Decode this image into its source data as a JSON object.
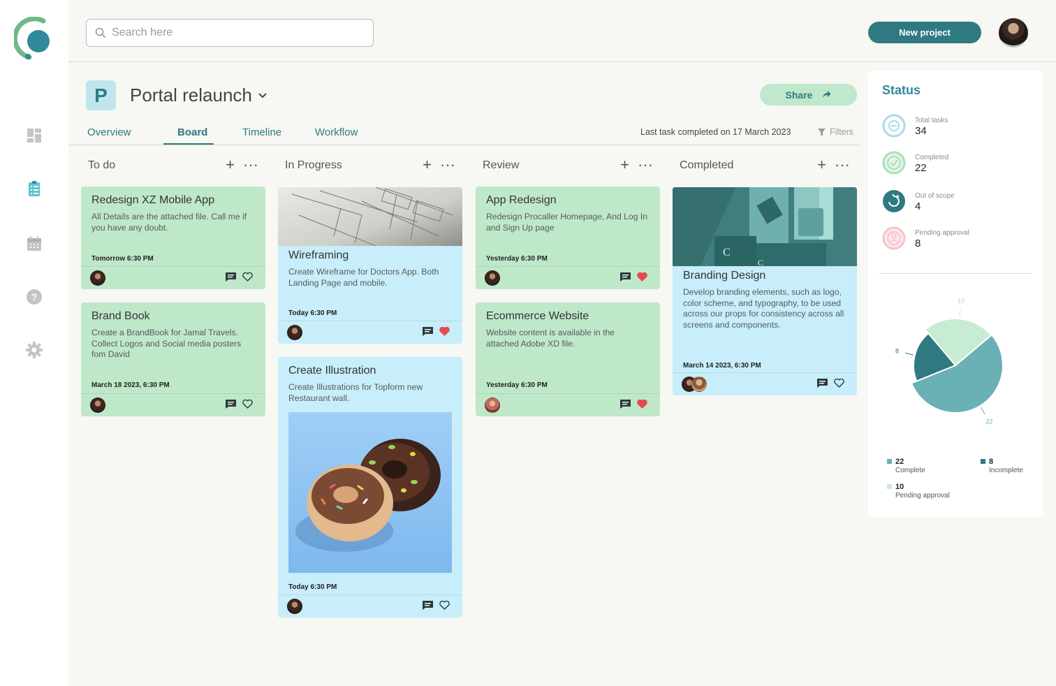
{
  "header": {
    "search_placeholder": "Search here",
    "new_project_label": "New project"
  },
  "project": {
    "badge_letter": "P",
    "title": "Portal relaunch",
    "share_label": "Share"
  },
  "tabs": [
    {
      "label": "Overview"
    },
    {
      "label": "Board"
    },
    {
      "label": "Timeline"
    },
    {
      "label": "Workflow"
    }
  ],
  "active_tab": "Board",
  "last_task_text": "Last task completed on 17 March 2023",
  "filters_label": "Filters",
  "columns": [
    {
      "title": "To do",
      "cards": [
        {
          "title": "Redesign XZ Mobile App",
          "desc": "All Details are the attached file. Call me if you have any doubt.",
          "date": "Tomorrow 6:30 PM",
          "liked": false
        },
        {
          "title": "Brand Book",
          "desc": "Create a BrandBook for Jamal Travels. Collect Logos and Social media posters fom David",
          "date": "March 18 2023, 6:30 PM",
          "liked": false
        }
      ]
    },
    {
      "title": "In Progress",
      "cards": [
        {
          "title": "Wireframing",
          "desc": "Create Wireframe for Doctors App. Both Landing Page and mobile.",
          "date": "Today 6:30 PM",
          "liked": true
        },
        {
          "title": "Create Illustration",
          "desc": "Create Illustrations for Topform new Restaurant wall.",
          "date": "Today 6:30 PM",
          "liked": false
        }
      ]
    },
    {
      "title": "Review",
      "cards": [
        {
          "title": "App Redesign",
          "desc": "Redesign Procaller Homepage, And Log In and Sign Up page",
          "date": "Yesterday 6:30 PM",
          "liked": true
        },
        {
          "title": "Ecommerce Website",
          "desc": "Website content is available in the attached Adobe XD file.",
          "date": "Yesterday 6:30 PM",
          "liked": true
        }
      ]
    },
    {
      "title": "Completed",
      "cards": [
        {
          "title": "Branding Design",
          "desc": "Develop branding elements, such as logo, color scheme, and typography, to be used across our props for consistency across all screens and components.",
          "date": "March 14 2023, 6:30 PM",
          "liked": false
        }
      ]
    }
  ],
  "status": {
    "title": "Status",
    "items": [
      {
        "label": "Total tasks",
        "value": "34",
        "color": "#9fd3e0",
        "icon": "minus-circle-icon"
      },
      {
        "label": "Completed",
        "value": "22",
        "color": "#a9e0b9",
        "icon": "check-circle-icon"
      },
      {
        "label": "Out of scope",
        "value": "4",
        "color": "#2f7a80",
        "icon": "refresh-circle-icon"
      },
      {
        "label": "Pending approval",
        "value": "8",
        "color": "#f6c4cc",
        "icon": "user-circle-icon"
      }
    ]
  },
  "chart_data": {
    "type": "pie",
    "categories": [
      "Complete",
      "Incomplete",
      "Pending approval"
    ],
    "values": [
      22,
      8,
      10
    ],
    "colors": [
      "#69b1b4",
      "#2f7a80",
      "#c8ecd3"
    ],
    "legend": [
      {
        "value": "22",
        "label": "Complete"
      },
      {
        "value": "8",
        "label": "Incomplete"
      },
      {
        "value": "10",
        "label": "Pending approval"
      }
    ]
  }
}
